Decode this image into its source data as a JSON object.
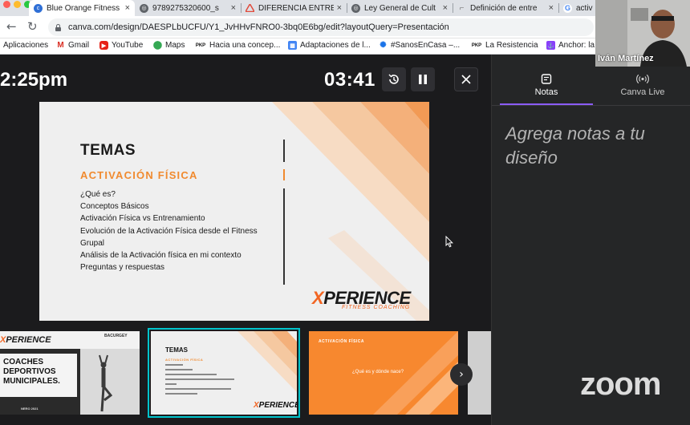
{
  "browser": {
    "tabs": [
      {
        "label": "Blue Orange Fitness",
        "active": true,
        "icon": "canva-icon"
      },
      {
        "label": "9789275320600_s",
        "active": false,
        "icon": "globe-icon"
      },
      {
        "label": "DIFERENCIA ENTRE",
        "active": false,
        "icon": "drive-icon"
      },
      {
        "label": "Ley General de Cult",
        "active": false,
        "icon": "globe-icon"
      },
      {
        "label": "Definición de entre",
        "active": false,
        "icon": "page-icon"
      },
      {
        "label": "activ",
        "active": false,
        "icon": "google-icon"
      }
    ],
    "url": "canva.com/design/DAESPLbUCFU/Y1_JvHHvFNRO0-3bq0E6bg/edit?layoutQuery=Presentación",
    "bookmarks": [
      {
        "label": "Aplicaciones",
        "icon": "apps-grid-icon"
      },
      {
        "label": "Gmail",
        "icon": "gmail-icon"
      },
      {
        "label": "YouTube",
        "icon": "youtube-icon"
      },
      {
        "label": "Maps",
        "icon": "maps-icon"
      },
      {
        "label": "Hacia una concep...",
        "icon": "pkp-icon",
        "icon_text": "PKP"
      },
      {
        "label": "Adaptaciones de l...",
        "icon": "calendar-icon"
      },
      {
        "label": "#SanosEnCasa –...",
        "icon": "who-icon"
      },
      {
        "label": "La Resistencia",
        "icon": "pkp-icon",
        "icon_text": "PKP"
      },
      {
        "label": "Anchor: la",
        "icon": "anchor-icon"
      }
    ]
  },
  "presenter": {
    "clock": "2:25pm",
    "timer": "03:41",
    "controls": {
      "reset": "reset-timer-icon",
      "pause": "pause-icon",
      "close": "close-icon"
    }
  },
  "slide": {
    "title": "TEMAS",
    "subtitle": "ACTIVACIÓN FÍSICA",
    "items": [
      "¿Qué es?",
      "Conceptos Básicos",
      "Activación Física vs Entrenamiento",
      "Evolución de la Activación Física desde el Fitness",
      "Grupal",
      "Análisis de la Activación física en mi contexto",
      "Preguntas y respuestas"
    ],
    "brand_x": "X",
    "brand": "PERIENCE",
    "brand_sub": "FITNESS COACHING"
  },
  "thumbnails": {
    "t1": {
      "brand_x": "X",
      "brand": "PERIENCE",
      "org": "BACURGEY",
      "title_lines": [
        "COACHES",
        "DEPORTIVOS",
        "MUNICIPALES."
      ],
      "footer": "NERO 2021"
    },
    "t2": {
      "title": "TEMAS",
      "subtitle": "ACTIVACIÓN FÍSICA",
      "brand_x": "X",
      "brand": "PERIENCE"
    },
    "t3": {
      "header": "ACTIVACIÓN FÍSICA",
      "question": "¿Qué es y dónde nace?"
    }
  },
  "panel": {
    "tabs": [
      {
        "label": "Notas",
        "icon": "notes-icon"
      },
      {
        "label": "Canva Live",
        "icon": "broadcast-icon"
      }
    ],
    "notes_placeholder": "Agrega notas a tu diseño"
  },
  "zoom": {
    "participant": "Iván Martínez",
    "logo": "zoom"
  },
  "colors": {
    "accent_orange": "#f08a2f",
    "selected_outline": "#00c4cc",
    "tab_underline": "#8b5cf6",
    "background": "#1b1b1d"
  }
}
